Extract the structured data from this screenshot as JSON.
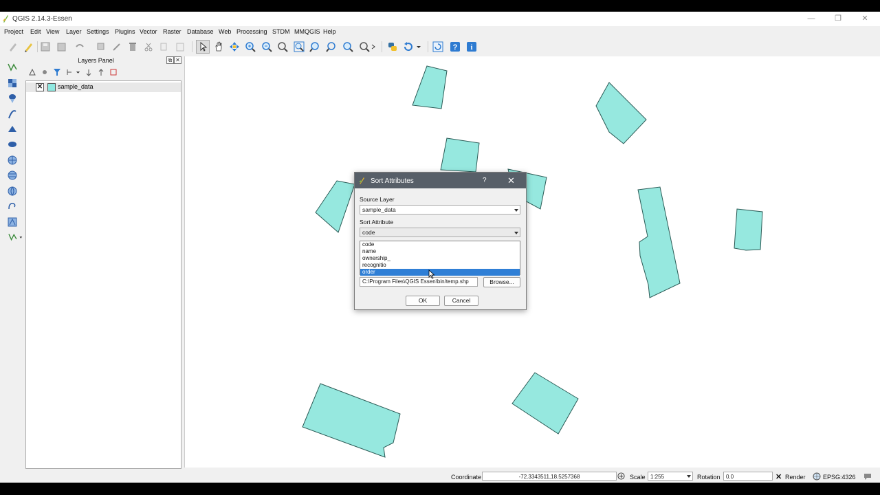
{
  "window": {
    "title": "QGIS 2.14.3-Essen"
  },
  "menu": [
    "Project",
    "Edit",
    "View",
    "Layer",
    "Settings",
    "Plugins",
    "Vector",
    "Raster",
    "Database",
    "Web",
    "Processing",
    "STDM",
    "MMQGIS",
    "Help"
  ],
  "toolbar_icons": [
    "digitize-icon",
    "pencil-icon",
    "save-icon",
    "save-as-icon",
    "add-feature-icon",
    "node-tool-icon",
    "delete-icon",
    "cut-icon",
    "copy-icon",
    "paste-icon",
    "pan-cursor-icon",
    "pan-hand-icon",
    "pan-to-selection-icon",
    "zoom-in-icon",
    "zoom-out-icon",
    "zoom-native-icon",
    "zoom-full-icon",
    "zoom-layer-icon",
    "zoom-selection-icon",
    "zoom-last-icon",
    "zoom-next-icon",
    "python-icon",
    "refresh-icon",
    "qgis-plugin-icon",
    "help-icon",
    "info-icon"
  ],
  "layers_panel": {
    "title": "Layers Panel",
    "layers": [
      {
        "name": "sample_data",
        "visible": true,
        "color": "#8fe8e0"
      }
    ]
  },
  "map": {
    "fill": "#96e8df",
    "stroke": "#2a5a55"
  },
  "status": {
    "coordinate_label": "Coordinate",
    "coordinate_value": "-72.3343511,18.5257368",
    "scale_label": "Scale",
    "scale_value": "1:255",
    "rotation_label": "Rotation",
    "rotation_value": "0.0",
    "render_label": "Render",
    "crs": "EPSG:4326"
  },
  "dialog": {
    "title": "Sort Attributes",
    "help": "?",
    "close": "✕",
    "source_layer_label": "Source Layer",
    "source_layer_value": "sample_data",
    "sort_attribute_label": "Sort Attribute",
    "sort_attribute_value": "code",
    "options": [
      "code",
      "name",
      "ownership_",
      "recognitio",
      "order"
    ],
    "highlighted_option": "order",
    "output_path": "C:\\Program Files\\QGIS Essen\\bin/temp.shp",
    "browse_label": "Browse...",
    "ok_label": "OK",
    "cancel_label": "Cancel"
  }
}
